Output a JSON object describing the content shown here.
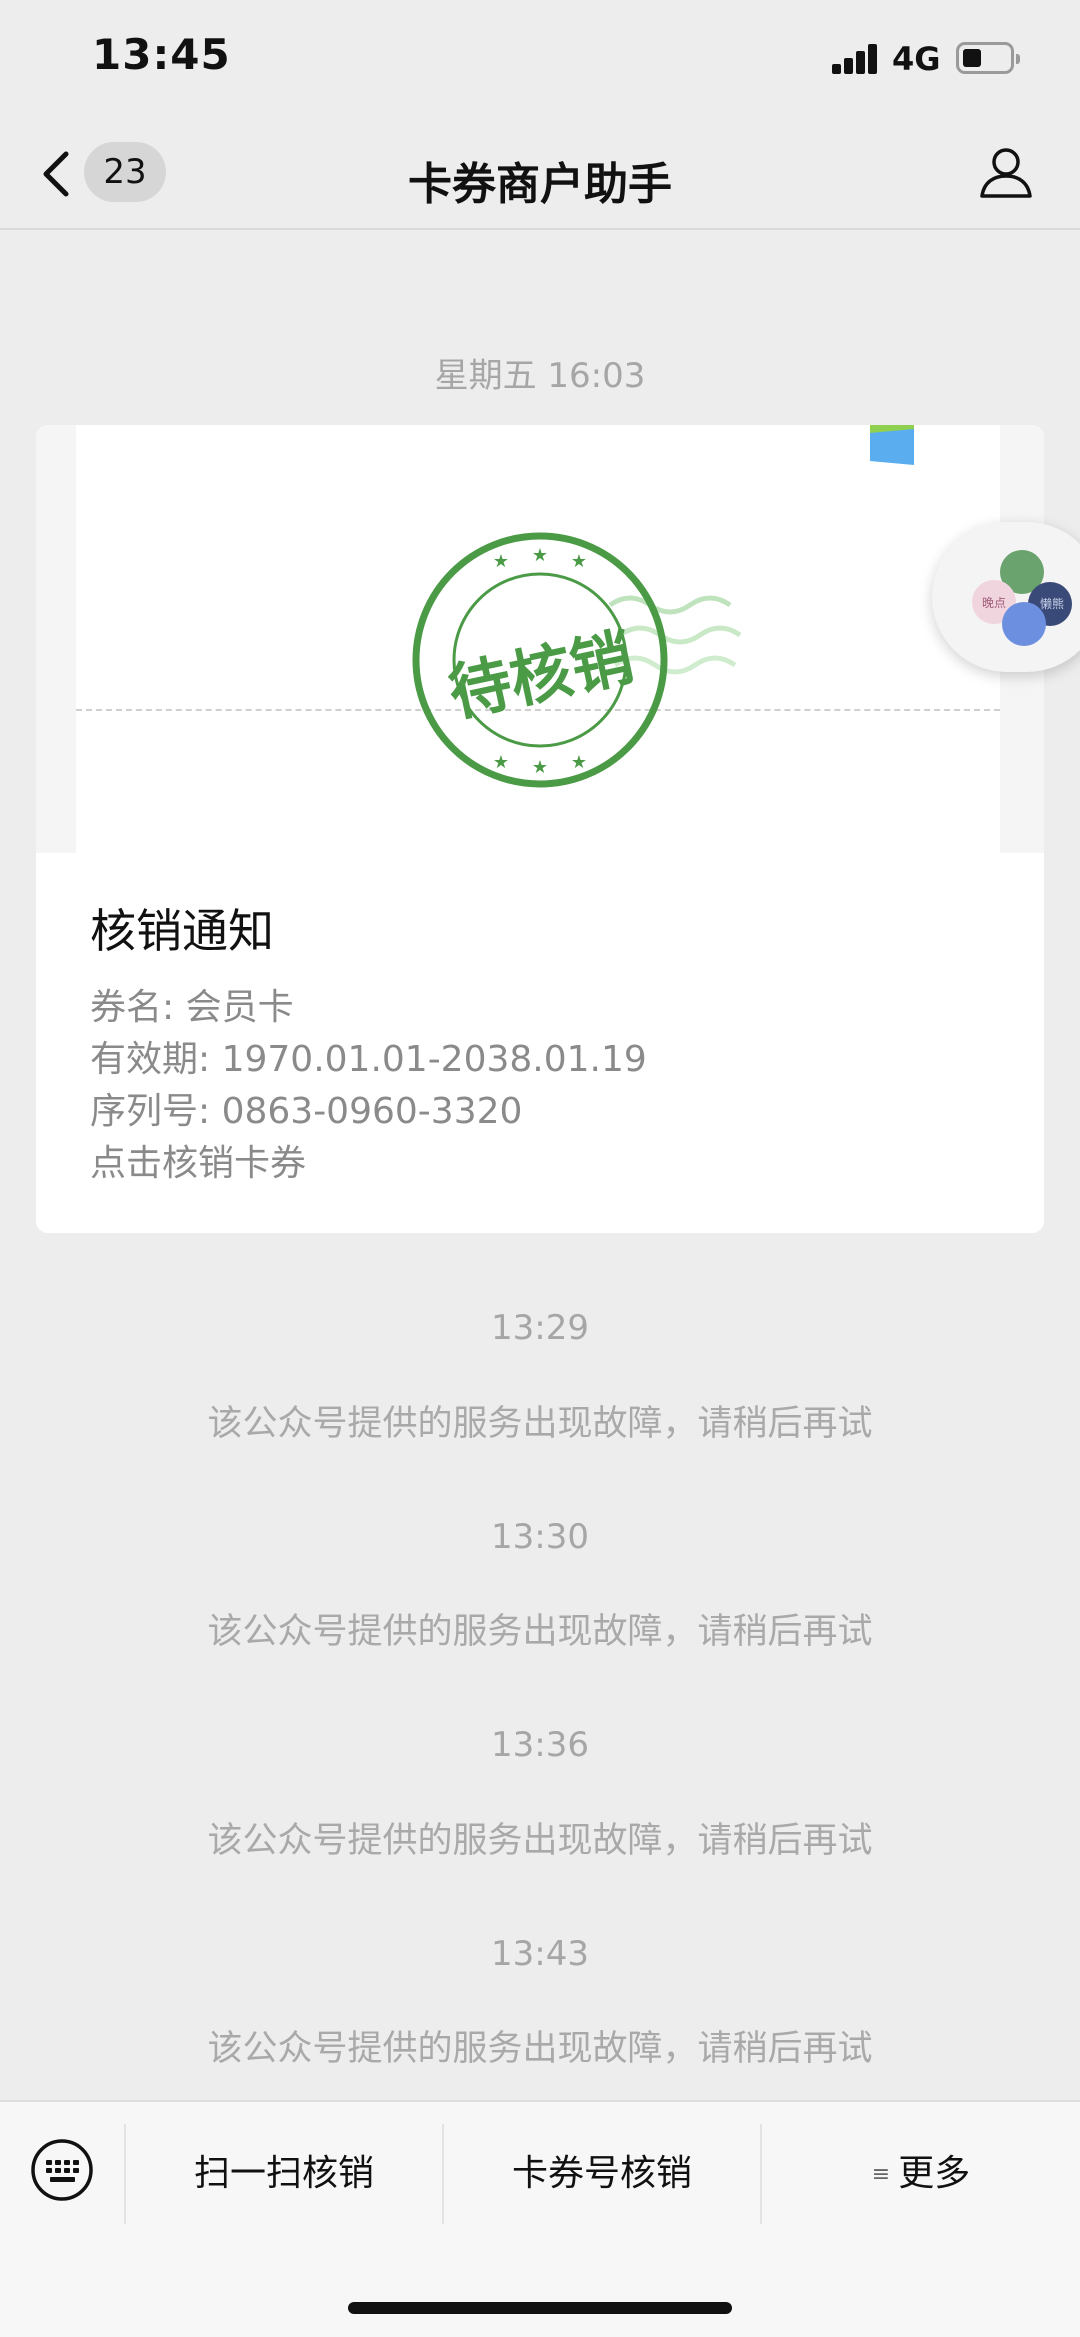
{
  "status_bar": {
    "time": "13:45",
    "network": "4G",
    "icons": [
      "signal-icon",
      "battery-icon"
    ]
  },
  "nav": {
    "back_icon": "chevron-left-icon",
    "unread_count": "23",
    "title": "卡券商户助手",
    "profile_icon": "person-icon"
  },
  "chat": {
    "first_timestamp": "星期五 16:03",
    "card": {
      "stamp_text": "待核销",
      "title": "核销通知",
      "coupon_name": "券名: 会员卡",
      "validity": "有效期: 1970.01.01-2038.01.19",
      "serial": "序列号: 0863-0960-3320",
      "action": "点击核销卡券"
    },
    "messages": [
      {
        "time": "13:29",
        "text": "该公众号提供的服务出现故障，请稍后再试"
      },
      {
        "time": "13:30",
        "text": "该公众号提供的服务出现故障，请稍后再试"
      },
      {
        "time": "13:36",
        "text": "该公众号提供的服务出现故障，请稍后再试"
      },
      {
        "time": "13:43",
        "text": "该公众号提供的服务出现故障，请稍后再试"
      }
    ]
  },
  "floating_bubble": {
    "icon": "mini-program-bubble-icon",
    "labels": [
      "晚点",
      "懒熊"
    ]
  },
  "bottom_menu": {
    "keyboard_icon": "keyboard-icon",
    "items": [
      "扫一扫核销",
      "卡券号核销",
      "更多"
    ],
    "more_icon": "menu-lines-icon"
  },
  "colors": {
    "background": "#ededed",
    "stamp_green": "#4a9a46",
    "secondary_text": "#a6a6a6"
  }
}
